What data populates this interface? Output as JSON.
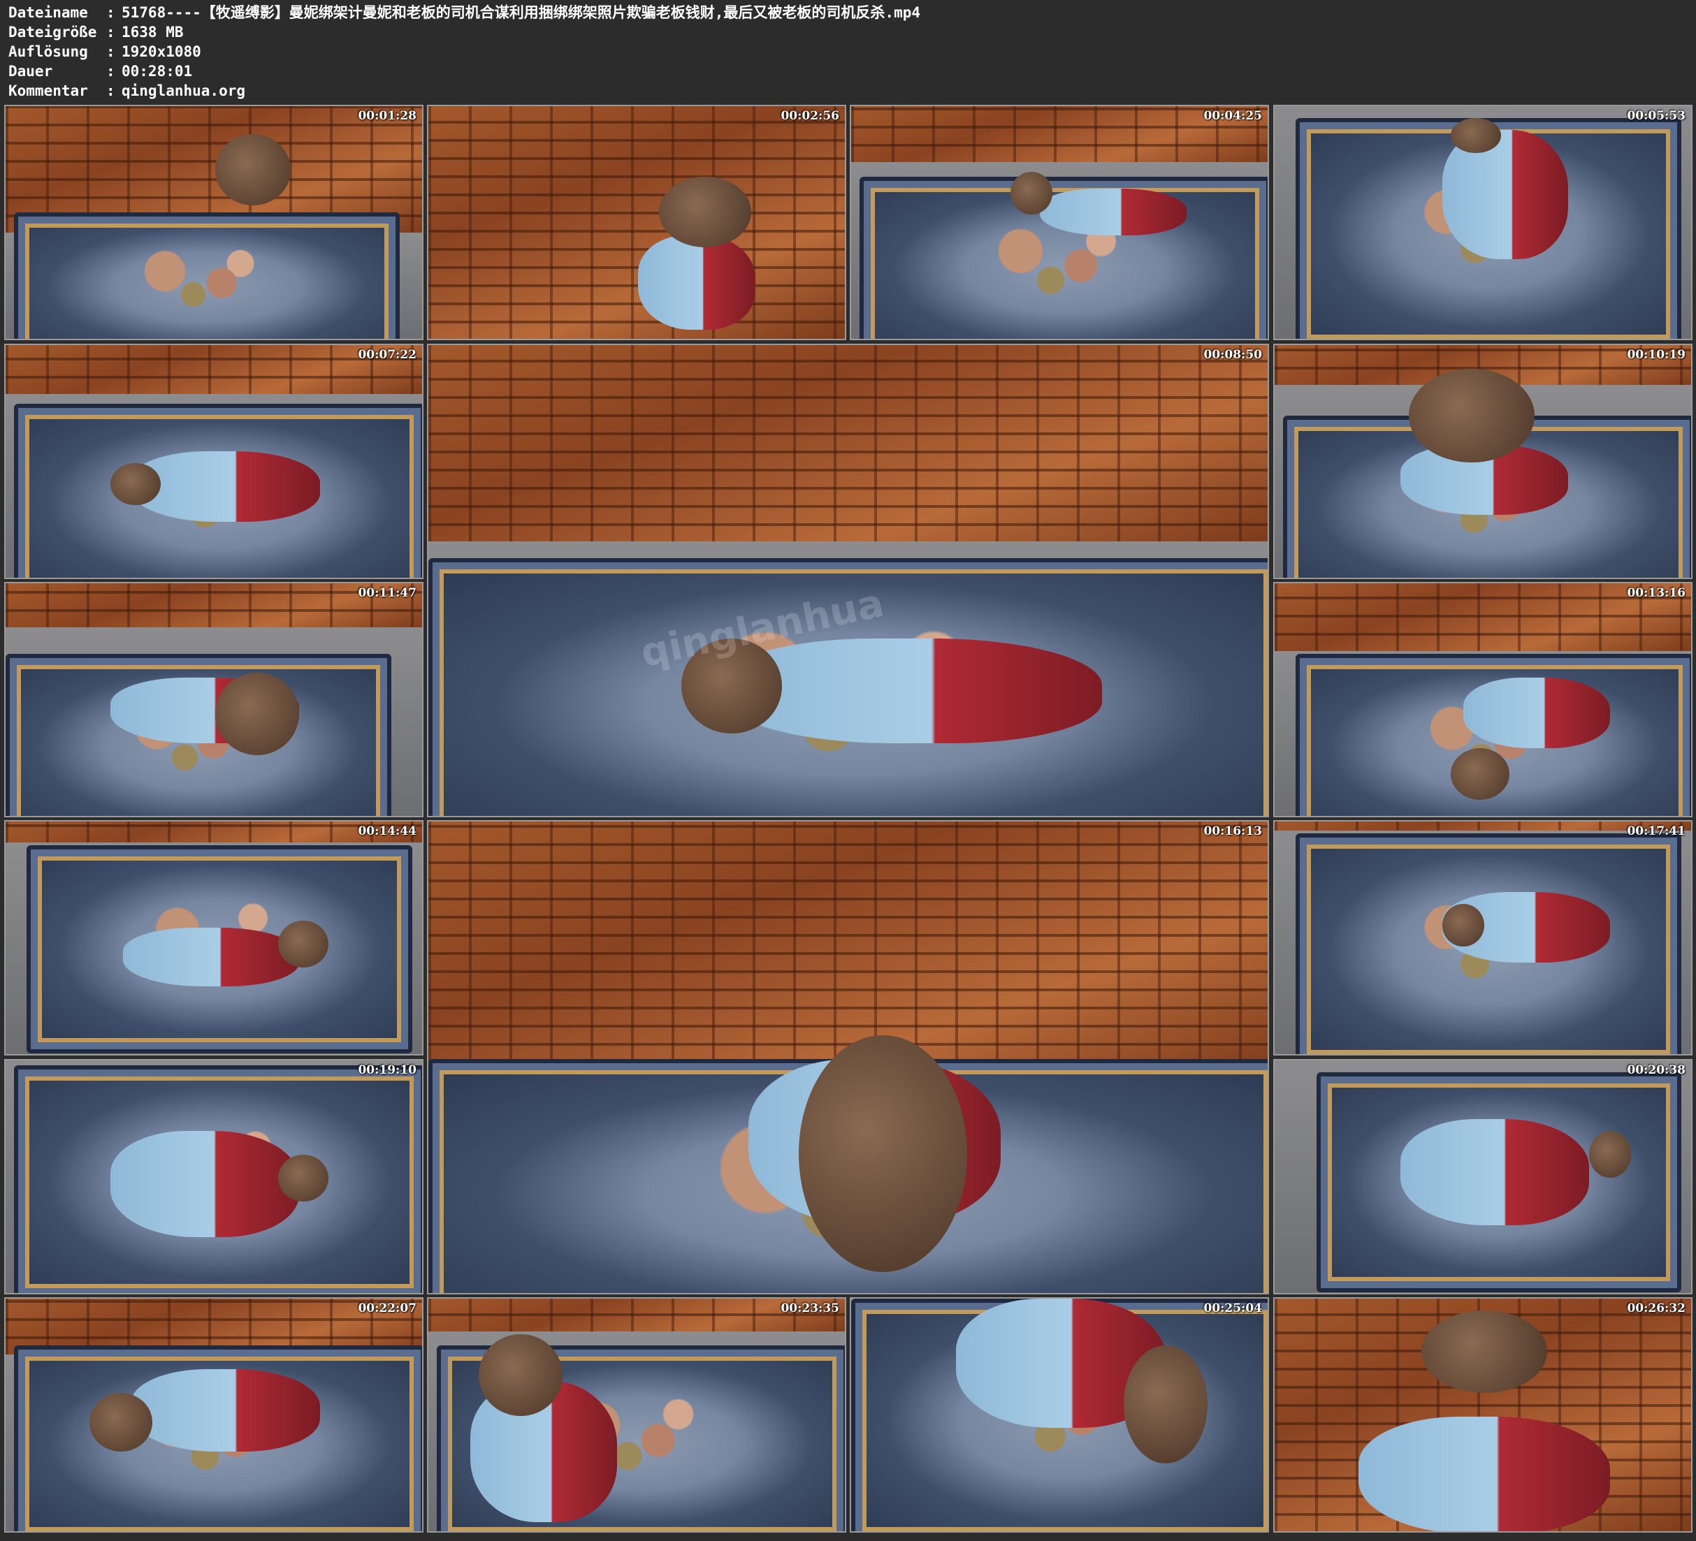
{
  "info": {
    "rows": [
      {
        "key": "Dateiname",
        "value": "51768----【牧遥缚影】曼妮绑架计曼妮和老板的司机合谋利用捆绑绑架照片欺骗老板钱财,最后又被老板的司机反杀.mp4"
      },
      {
        "key": "Dateigröße",
        "value": "1638 MB"
      },
      {
        "key": "Auflösung",
        "value": "1920x1080"
      },
      {
        "key": "Dauer",
        "value": "00:28:01"
      },
      {
        "key": "Kommentar",
        "value": "qinglanhua.org"
      }
    ],
    "separator": ":"
  },
  "thumbnails": [
    {
      "timestamp": "00:01:28"
    },
    {
      "timestamp": "00:02:56"
    },
    {
      "timestamp": "00:04:25"
    },
    {
      "timestamp": "00:05:53"
    },
    {
      "timestamp": "00:07:22"
    },
    {
      "timestamp": "00:08:50"
    },
    {
      "timestamp": "00:10:19"
    },
    {
      "timestamp": "00:11:47"
    },
    {
      "timestamp": "00:13:16"
    },
    {
      "timestamp": "00:14:44"
    },
    {
      "timestamp": "00:16:13"
    },
    {
      "timestamp": "00:17:41"
    },
    {
      "timestamp": "00:19:10"
    },
    {
      "timestamp": "00:20:38"
    },
    {
      "timestamp": "00:22:07"
    },
    {
      "timestamp": "00:23:35"
    },
    {
      "timestamp": "00:25:04"
    },
    {
      "timestamp": "00:26:32"
    }
  ],
  "watermark": "qinglanhua"
}
